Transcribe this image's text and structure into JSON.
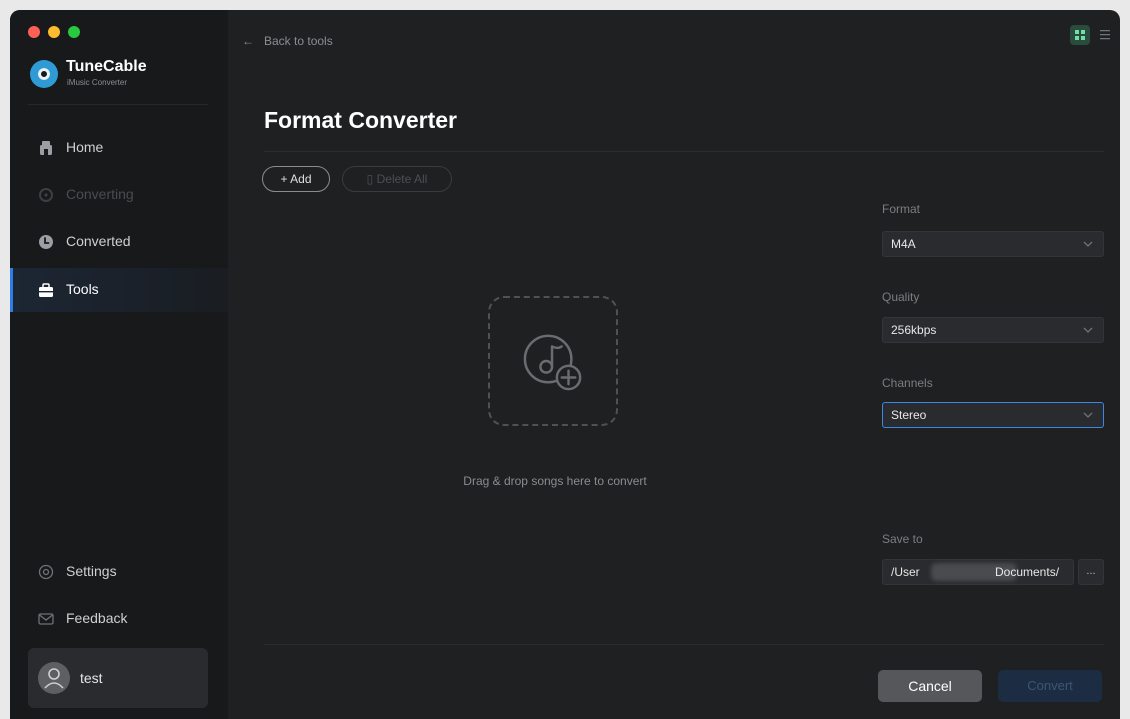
{
  "window": {
    "traffic_lights": [
      {
        "name": "close",
        "color": "#fe5f57"
      },
      {
        "name": "minimize",
        "color": "#febb2e"
      },
      {
        "name": "zoom",
        "color": "#28c840"
      }
    ]
  },
  "brand": {
    "name": "TuneCable",
    "subtitle": "iMusic Converter"
  },
  "sidebar": {
    "items": [
      {
        "label": "Home",
        "icon": "home-icon",
        "state": "normal"
      },
      {
        "label": "Converting",
        "icon": "converting-icon",
        "state": "disabled"
      },
      {
        "label": "Converted",
        "icon": "clock-icon",
        "state": "normal"
      },
      {
        "label": "Tools",
        "icon": "toolbox-icon",
        "state": "active"
      }
    ],
    "bottom": [
      {
        "label": "Settings",
        "icon": "gear-icon"
      },
      {
        "label": "Feedback",
        "icon": "mail-icon"
      }
    ],
    "user": {
      "name": "test"
    }
  },
  "header": {
    "back_label": "Back to tools"
  },
  "main": {
    "title": "Format Converter",
    "add_label": "+ Add",
    "delete_all_label": "Delete All",
    "drop_text": "Drag & drop songs here to convert"
  },
  "settings": {
    "format": {
      "label": "Format",
      "value": "M4A"
    },
    "quality": {
      "label": "Quality",
      "value": "256kbps"
    },
    "channels": {
      "label": "Channels",
      "value": "Stereo"
    },
    "save_to": {
      "label": "Save to",
      "value_start": "/User",
      "value_end": "Documents/",
      "browse_label": "..."
    }
  },
  "footer": {
    "cancel_label": "Cancel",
    "convert_label": "Convert"
  },
  "colors": {
    "accent": "#2b7de9",
    "background": "#1f2022",
    "sidebar": "#18191b"
  }
}
